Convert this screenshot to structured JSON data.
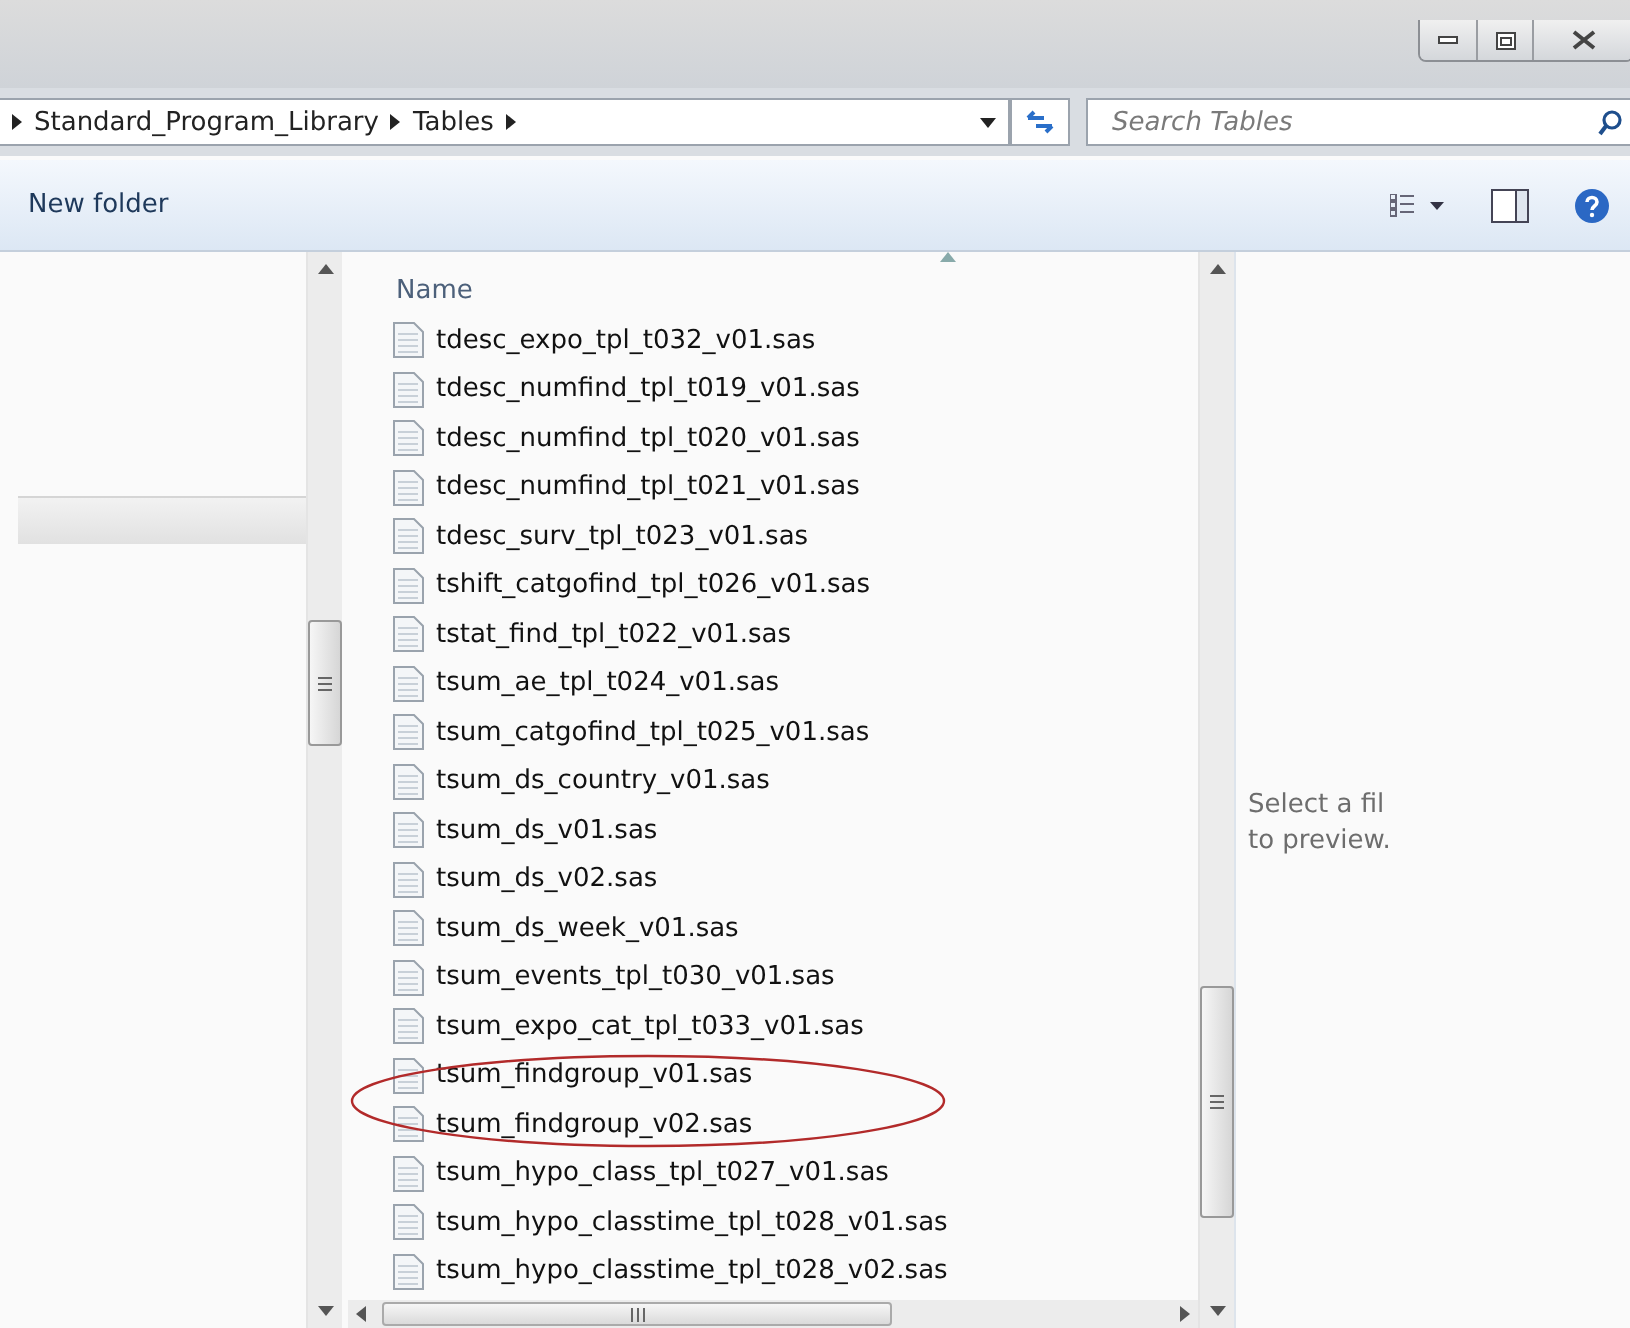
{
  "address_bar": {
    "breadcrumb": [
      "Standard_Program_Library",
      "Tables"
    ]
  },
  "search": {
    "placeholder": "Search Tables"
  },
  "toolbar": {
    "new_folder": "New folder"
  },
  "file_list": {
    "column": "Name",
    "files": [
      {
        "name": "tdesc_expo_tpl_t032_v01.sas",
        "circled": false
      },
      {
        "name": "tdesc_numfind_tpl_t019_v01.sas",
        "circled": false
      },
      {
        "name": "tdesc_numfind_tpl_t020_v01.sas",
        "circled": false
      },
      {
        "name": "tdesc_numfind_tpl_t021_v01.sas",
        "circled": false
      },
      {
        "name": "tdesc_surv_tpl_t023_v01.sas",
        "circled": false
      },
      {
        "name": "tshift_catgofind_tpl_t026_v01.sas",
        "circled": false
      },
      {
        "name": "tstat_find_tpl_t022_v01.sas",
        "circled": false
      },
      {
        "name": "tsum_ae_tpl_t024_v01.sas",
        "circled": false
      },
      {
        "name": "tsum_catgofind_tpl_t025_v01.sas",
        "circled": false
      },
      {
        "name": "tsum_ds_country_v01.sas",
        "circled": false
      },
      {
        "name": "tsum_ds_v01.sas",
        "circled": false
      },
      {
        "name": "tsum_ds_v02.sas",
        "circled": false
      },
      {
        "name": "tsum_ds_week_v01.sas",
        "circled": false
      },
      {
        "name": "tsum_events_tpl_t030_v01.sas",
        "circled": false
      },
      {
        "name": "tsum_expo_cat_tpl_t033_v01.sas",
        "circled": false
      },
      {
        "name": "tsum_findgroup_v01.sas",
        "circled": true
      },
      {
        "name": "tsum_findgroup_v02.sas",
        "circled": true
      },
      {
        "name": "tsum_hypo_class_tpl_t027_v01.sas",
        "circled": false
      },
      {
        "name": "tsum_hypo_classtime_tpl_t028_v01.sas",
        "circled": false
      },
      {
        "name": "tsum_hypo_classtime_tpl_t028_v02.sas",
        "circled": false
      }
    ]
  },
  "preview": {
    "lines": [
      "Select a fil",
      "to preview."
    ]
  }
}
